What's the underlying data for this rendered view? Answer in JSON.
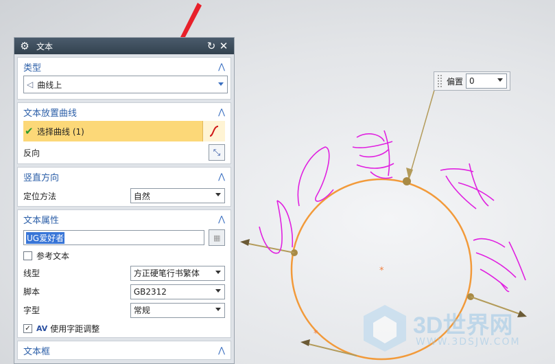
{
  "dialog": {
    "title": "文本",
    "sections": {
      "type": {
        "header": "类型",
        "value": "曲线上"
      },
      "placement": {
        "header": "文本放置曲线",
        "select_curve": "选择曲线 (1)",
        "reverse": "反向"
      },
      "vertical": {
        "header": "竖直方向",
        "method_label": "定位方法",
        "method_value": "自然"
      },
      "attributes": {
        "header": "文本属性",
        "text_value": "UG爱好者",
        "ref_text": "参考文本",
        "line_label": "线型",
        "line_value": "方正硬笔行书繁体",
        "script_label": "脚本",
        "script_value": "GB2312",
        "style_label": "字型",
        "style_value": "常规",
        "kerning": "使用字距调整"
      },
      "frame": {
        "header": "文本框"
      }
    }
  },
  "viewport": {
    "offset_label": "偏置",
    "offset_value": "0",
    "watermark_main": "3D世界网",
    "watermark_url": "WWW.3DSJW.COM",
    "colors": {
      "curve": "#f29a3a",
      "text": "#e020e0",
      "arrow": "#b39b5a",
      "arrow_red": "#e8202a"
    }
  }
}
